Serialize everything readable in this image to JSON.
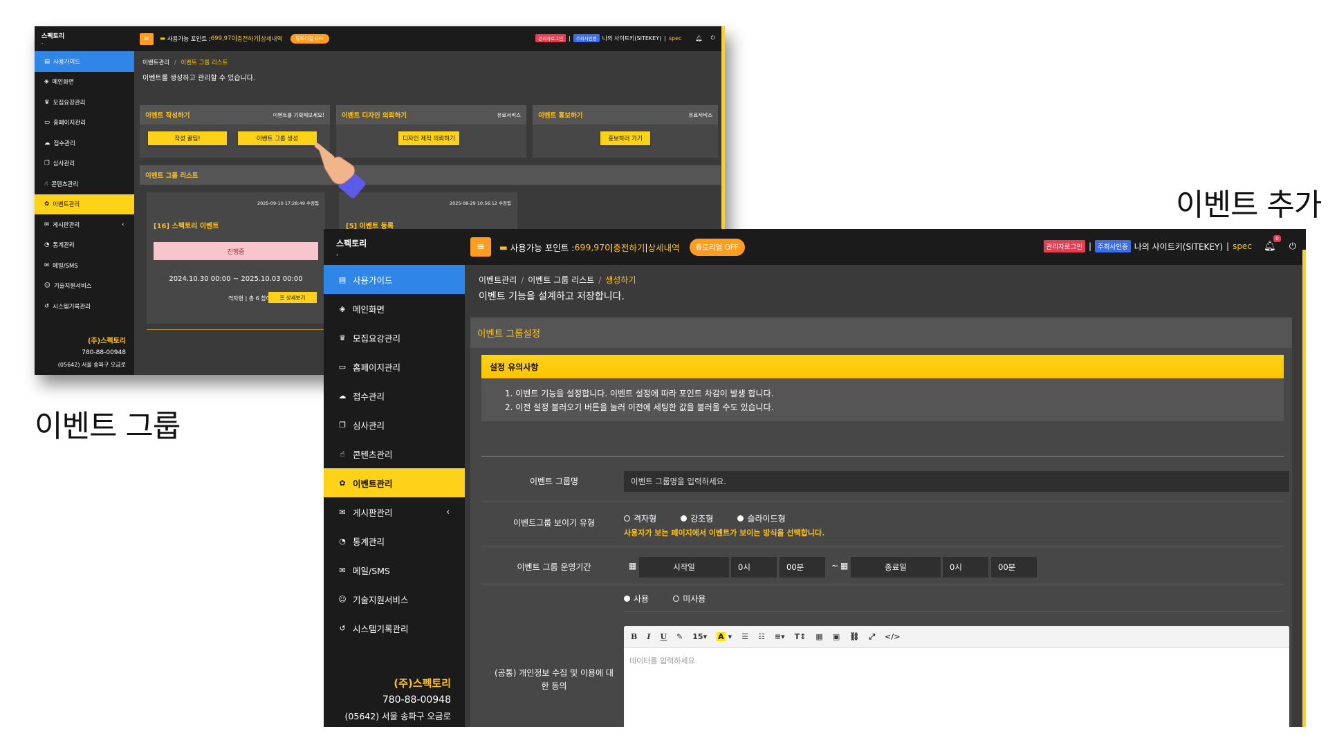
{
  "captions": {
    "event_add": "이벤트 추가",
    "event_group": "이벤트 그룹"
  },
  "colors": {
    "accent_yellow": "#ffd21a",
    "accent_orange": "#ff9c22",
    "active_blue": "#2f86e6",
    "dark_bg": "#1b1b1b",
    "content_bg": "#3a3a3a"
  },
  "header": {
    "points_label": "사용가능 포인트 : ",
    "points_value": "699,970",
    "charge": "충전하기",
    "history": "상세내역",
    "separator": " | ",
    "tutorial_pill": "튜토리얼 OFF",
    "admin_login_badge": "관리자로그인",
    "main_site_badge": "주최사인증",
    "site_key": "나의 사이트키(SITEKEY)",
    "user": "spec",
    "bell_count": "0"
  },
  "sidebar": {
    "brand": "스펙토리",
    "brand_sub": "-",
    "items": [
      {
        "label": "사용가이드",
        "icon": "book-icon"
      },
      {
        "label": "메인화면",
        "icon": "cube-icon"
      },
      {
        "label": "모집요강관리",
        "icon": "trophy-icon"
      },
      {
        "label": "홈페이지관리",
        "icon": "monitor-icon"
      },
      {
        "label": "접수관리",
        "icon": "cloud-upload-icon"
      },
      {
        "label": "심사관리",
        "icon": "copy-icon"
      },
      {
        "label": "콘텐츠관리",
        "icon": "thumbs-up-icon"
      },
      {
        "label": "이벤트관리",
        "icon": "gift-icon"
      },
      {
        "label": "게시판관리",
        "icon": "comments-icon"
      },
      {
        "label": "통계관리",
        "icon": "pie-chart-icon"
      },
      {
        "label": "메일/SMS",
        "icon": "envelope-icon"
      },
      {
        "label": "기술지원서비스",
        "icon": "smile-icon"
      },
      {
        "label": "시스템기록관리",
        "icon": "history-icon"
      }
    ],
    "footer": {
      "company": "(주)스펙토리",
      "biz_no": "780-88-00948",
      "address": "(05642) 서울 송파구 오금로"
    }
  },
  "group_page": {
    "breadcrumb": [
      "이벤트관리",
      "이벤트 그룹 리스트"
    ],
    "description": "이벤트를 생성하고 관리할 수 있습니다.",
    "cards": [
      {
        "title": "이벤트 작성하기",
        "right": "이벤트를 기획해보세요!",
        "buttons": [
          "작성 꿀팁!",
          "이벤트 그룹 생성"
        ]
      },
      {
        "title": "이벤트 디자인 의뢰하기",
        "right": "유료서비스",
        "buttons": [
          "디자인 제작 의뢰하기"
        ]
      },
      {
        "title": "이벤트 홍보하기",
        "right": "유료서비스",
        "buttons": [
          "홍보하러 가기"
        ]
      }
    ],
    "list_title": "이벤트 그룹 리스트",
    "events": [
      {
        "date": "2025-09-10 17:28:49 수정됨",
        "title": "[16] 스펙토리 이벤트",
        "status": "진행중",
        "period": "2024.10.30 00:00 ~ 2025.10.03 00:00",
        "meta": "격자형 | 총 6 참여",
        "detail_button": "☰ 상세보기"
      },
      {
        "date": "2025-08-29 10:56:12 수정됨",
        "title": "[5] 이벤트 등록"
      }
    ]
  },
  "add_page": {
    "breadcrumb": [
      "이벤트관리",
      "이벤트 그룹 리스트",
      "생성하기"
    ],
    "description": "이벤트 기능을 설계하고 저장합니다.",
    "panel_title": "이벤트 그룹설정",
    "notice": {
      "title": "설정 유의사항",
      "lines": [
        "1. 이벤트 기능을 설정합니다. 이벤트 설정에 따라 포인트 차감이 발생 합니다.",
        "2. 이전 설정 불러오기 버튼을 눌러 이전에 세팅한 값을 불러올 수도 있습니다."
      ]
    },
    "fields": {
      "group_name_label": "이벤트 그룹명",
      "group_name_placeholder": "이벤트 그룹명을 입력하세요.",
      "view_type_label": "이벤트그룹 보이기 유형",
      "view_types": [
        "격자형",
        "강조형",
        "슬라이드형"
      ],
      "view_type_hint": "사용자가 보는 페이지에서 이벤트가 보이는 방식을 선택합니다.",
      "period_label": "이벤트 그룹 운영기간",
      "start_date": "시작일",
      "start_hour": "0시",
      "start_min": "00분",
      "tilde": "~",
      "end_date": "종료일",
      "end_hour": "0시",
      "end_min": "00분",
      "consent_label": "(공통) 개인정보 수집 및 이용에 대한 동의",
      "consent_options": [
        "사용",
        "미사용"
      ],
      "editor_placeholder": "데이터를 입력하세요."
    },
    "toolbar": [
      "B",
      "I",
      "U",
      "✎",
      "15▾",
      "A",
      "▾",
      "☰",
      "☷",
      "≡▾",
      "T↕",
      "▦",
      "▣",
      "⛓",
      "⤢",
      "</>"
    ]
  }
}
